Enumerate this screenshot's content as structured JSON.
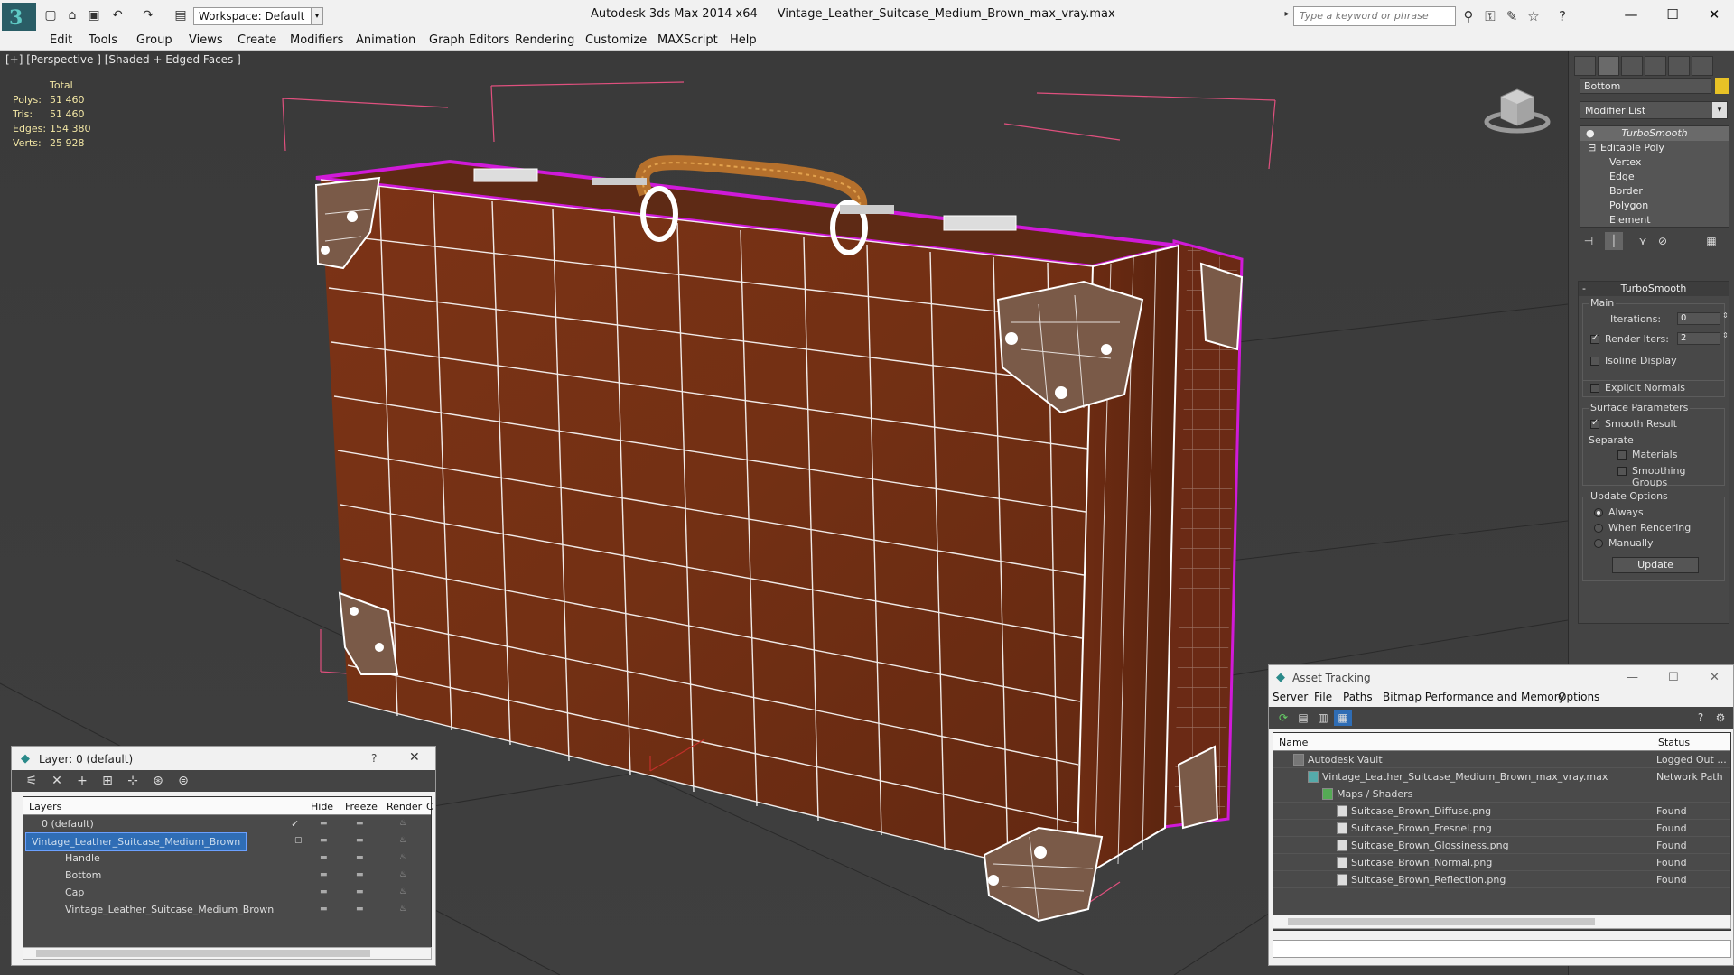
{
  "titlebar": {
    "app": "Autodesk 3ds Max  2014 x64",
    "file": "Vintage_Leather_Suitcase_Medium_Brown_max_vray.max",
    "workspace": "Workspace: Default",
    "search_placeholder": "Type a keyword or phrase",
    "minimize": "—",
    "maximize": "☐",
    "close": "✕"
  },
  "menu": [
    "Edit",
    "Tools",
    "Group",
    "Views",
    "Create",
    "Modifiers",
    "Animation",
    "Graph Editors",
    "Rendering",
    "Customize",
    "MAXScript",
    "Help"
  ],
  "viewport": {
    "label": "[+] [Perspective ] [Shaded + Edged Faces ]",
    "stats_header": "Total",
    "stats": [
      {
        "k": "Polys:",
        "v": "51 460"
      },
      {
        "k": "Tris:",
        "v": "51 460"
      },
      {
        "k": "Edges:",
        "v": "154 380"
      },
      {
        "k": "Verts:",
        "v": "25 928"
      }
    ],
    "colors": {
      "leather": "#7a2f14",
      "wire": "#ffffff",
      "selection": "#d01ad8",
      "bbox": "#e0507e",
      "handle": "#b5702c"
    }
  },
  "command_panel": {
    "object_name": "Bottom",
    "modifier_list": "Modifier List",
    "stack": {
      "top": "TurboSmooth",
      "base": "Editable Poly",
      "subs": [
        "Vertex",
        "Edge",
        "Border",
        "Polygon",
        "Element"
      ]
    },
    "turbosmooth": {
      "title": "TurboSmooth",
      "main_label": "Main",
      "iterations_label": "Iterations:",
      "iterations": "0",
      "render_iters_label": "Render Iters:",
      "render_iters": "2",
      "isoline": "Isoline Display",
      "explicit": "Explicit Normals",
      "surface_label": "Surface Parameters",
      "smooth_result": "Smooth Result",
      "separate_label": "Separate",
      "materials": "Materials",
      "smoothing_groups": "Smoothing Groups",
      "update_label": "Update Options",
      "always": "Always",
      "when_rendering": "When Rendering",
      "manually": "Manually",
      "update_btn": "Update"
    }
  },
  "layer_window": {
    "title": "Layer: 0 (default)",
    "help": "?",
    "close": "✕",
    "headers": {
      "layers": "Layers",
      "hide": "Hide",
      "freeze": "Freeze",
      "render": "Render",
      "c": "C"
    },
    "rows": [
      {
        "name": "0 (default)",
        "indent": 0
      },
      {
        "name": "Vintage_Leather_Suitcase_Medium_Brown",
        "indent": 0,
        "selected": true
      },
      {
        "name": "Handle",
        "indent": 1
      },
      {
        "name": "Bottom",
        "indent": 1
      },
      {
        "name": "Cap",
        "indent": 1
      },
      {
        "name": "Vintage_Leather_Suitcase_Medium_Brown",
        "indent": 1
      }
    ]
  },
  "asset_window": {
    "title": "Asset Tracking",
    "menu": [
      "Server",
      "File",
      "Paths",
      "Bitmap Performance and Memory",
      "Options"
    ],
    "headers": {
      "name": "Name",
      "status": "Status"
    },
    "rows": [
      {
        "name": "Autodesk Vault",
        "status": "Logged Out ...",
        "indent": 0
      },
      {
        "name": "Vintage_Leather_Suitcase_Medium_Brown_max_vray.max",
        "status": "Network Path",
        "indent": 1
      },
      {
        "name": "Maps / Shaders",
        "status": "",
        "indent": 2
      },
      {
        "name": "Suitcase_Brown_Diffuse.png",
        "status": "Found",
        "indent": 3
      },
      {
        "name": "Suitcase_Brown_Fresnel.png",
        "status": "Found",
        "indent": 3
      },
      {
        "name": "Suitcase_Brown_Glossiness.png",
        "status": "Found",
        "indent": 3
      },
      {
        "name": "Suitcase_Brown_Normal.png",
        "status": "Found",
        "indent": 3
      },
      {
        "name": "Suitcase_Brown_Reflection.png",
        "status": "Found",
        "indent": 3
      }
    ]
  }
}
